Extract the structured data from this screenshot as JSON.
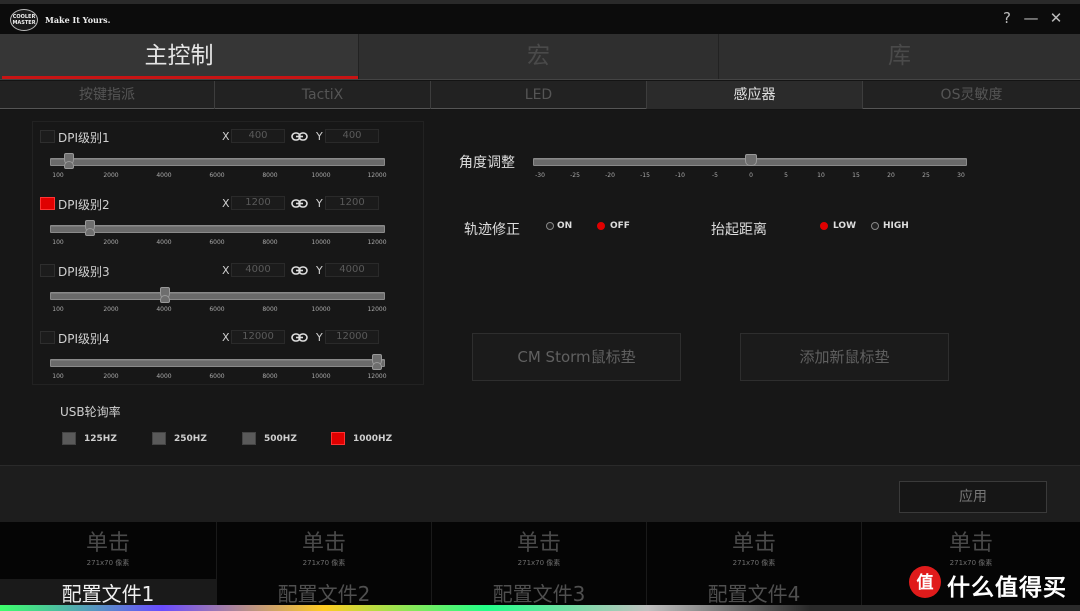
{
  "titlebar": {
    "logo_text": "COOLER MASTER",
    "slogan": "Make It Yours.",
    "help": "?",
    "minimize": "—",
    "close": "✕"
  },
  "main_tabs": [
    {
      "label": "主控制",
      "active": true
    },
    {
      "label": "宏",
      "active": false
    },
    {
      "label": "库",
      "active": false
    }
  ],
  "sub_tabs": [
    {
      "label": "按键指派",
      "active": false
    },
    {
      "label": "TactiX",
      "active": false
    },
    {
      "label": "LED",
      "active": false
    },
    {
      "label": "感应器",
      "active": true
    },
    {
      "label": "OS灵敏度",
      "active": false
    }
  ],
  "dpi": {
    "axis_x": "X",
    "axis_y": "Y",
    "levels": [
      {
        "label": "DPI级别1",
        "checked": false,
        "x": "400",
        "y": "400",
        "ticks": [
          "100",
          "2000",
          "4000",
          "6000",
          "8000",
          "10000",
          "12000"
        ],
        "value": 400
      },
      {
        "label": "DPI级别2",
        "checked": true,
        "x": "1200",
        "y": "1200",
        "ticks": [
          "100",
          "2000",
          "4000",
          "6000",
          "8000",
          "10000",
          "12000"
        ],
        "value": 1200
      },
      {
        "label": "DPI级别3",
        "checked": false,
        "x": "4000",
        "y": "4000",
        "ticks": [
          "100",
          "2000",
          "4000",
          "6000",
          "8000",
          "10000",
          "12000"
        ],
        "value": 4000
      },
      {
        "label": "DPI级别4",
        "checked": false,
        "x": "12000",
        "y": "12000",
        "ticks": [
          "100",
          "2000",
          "4000",
          "6000",
          "8000",
          "10000",
          "12000"
        ],
        "value": 12000
      }
    ],
    "slider_min": 100,
    "slider_max": 12000
  },
  "usb": {
    "title": "USB轮询率",
    "options": [
      {
        "label": "125HZ",
        "selected": false
      },
      {
        "label": "250HZ",
        "selected": false
      },
      {
        "label": "500HZ",
        "selected": false
      },
      {
        "label": "1000HZ",
        "selected": true
      }
    ]
  },
  "angle": {
    "label": "角度调整",
    "value": 0,
    "min": -30,
    "max": 30,
    "ticks": [
      "-30",
      "-25",
      "-20",
      "-15",
      "-10",
      "-5",
      "0",
      "5",
      "10",
      "15",
      "20",
      "25",
      "30"
    ]
  },
  "track_correction": {
    "label": "轨迹修正",
    "options": [
      {
        "label": "ON",
        "selected": false
      },
      {
        "label": "OFF",
        "selected": true
      }
    ]
  },
  "lift_distance": {
    "label": "抬起距离",
    "options": [
      {
        "label": "LOW",
        "selected": true
      },
      {
        "label": "HIGH",
        "selected": false
      }
    ]
  },
  "surface": {
    "cm_storm": "CM Storm鼠标垫",
    "add_new": "添加新鼠标垫"
  },
  "apply_label": "应用",
  "profiles": [
    {
      "action": "单击",
      "dims": "271x70 像素",
      "name": "配置文件1",
      "selected": true
    },
    {
      "action": "单击",
      "dims": "271x70 像素",
      "name": "配置文件2",
      "selected": false
    },
    {
      "action": "单击",
      "dims": "271x70 像素",
      "name": "配置文件3",
      "selected": false
    },
    {
      "action": "单击",
      "dims": "271x70 像素",
      "name": "配置文件4",
      "selected": false
    },
    {
      "action": "单击",
      "dims": "271x70 像素",
      "name": "",
      "selected": false
    }
  ],
  "watermark": "什么值得买",
  "colors": {
    "accent_red": "#e00000",
    "active_tab_underline": "#c81414"
  }
}
